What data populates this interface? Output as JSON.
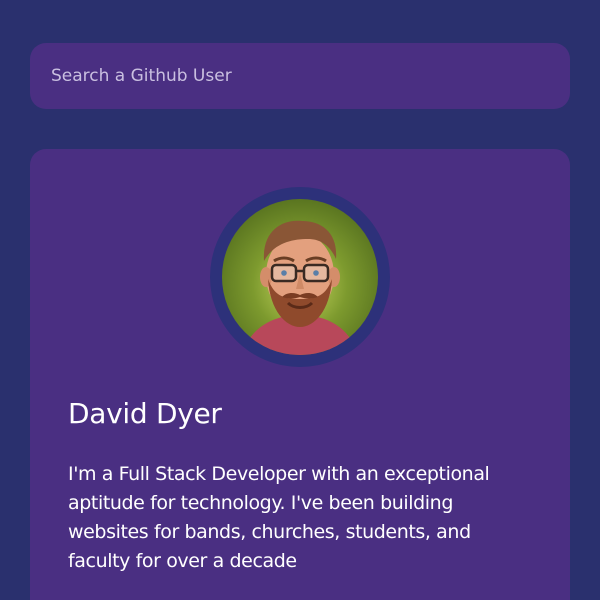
{
  "search": {
    "placeholder": "Search a Github User",
    "value": ""
  },
  "profile": {
    "avatar_icon": "user-avatar-illustration",
    "name": "David Dyer",
    "bio": "I'm a Full Stack Developer with an exceptional aptitude for technology. I've been building websites for bands, churches, students, and faculty for over a decade"
  },
  "colors": {
    "background": "#2a306e",
    "surface": "#4a2f82",
    "avatar_ring": "#2d317a",
    "text": "#ffffff",
    "placeholder": "#c9bfe0"
  }
}
